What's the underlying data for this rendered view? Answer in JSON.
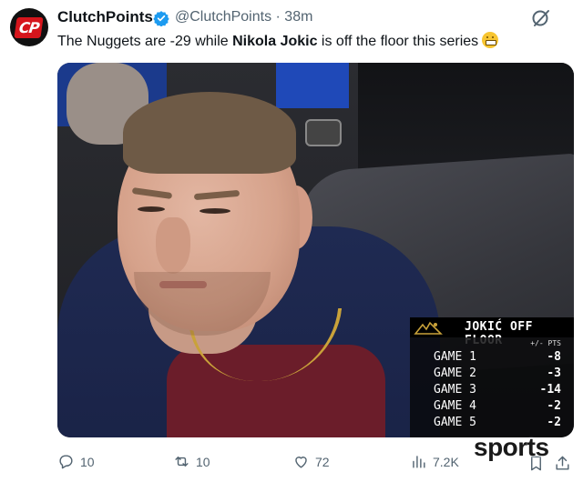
{
  "tweet": {
    "author_name": "ClutchPoints",
    "handle": "@ClutchPoints",
    "separator": "·",
    "time": "38m",
    "text_before": "The Nuggets are -29 while ",
    "text_bold": "Nikola Jokic",
    "text_after": " is off the floor this series",
    "emoji": "grimacing-face"
  },
  "overlay": {
    "title": "JOKIĆ OFF FLOOR",
    "column_header": "+/- PTS",
    "rows": [
      {
        "game": "GAME 1",
        "value": "-8"
      },
      {
        "game": "GAME 2",
        "value": "-3"
      },
      {
        "game": "GAME 3",
        "value": "-14"
      },
      {
        "game": "GAME 4",
        "value": "-2"
      },
      {
        "game": "GAME 5",
        "value": "-2"
      }
    ]
  },
  "actions": {
    "replies": "10",
    "reposts": "10",
    "likes": "72",
    "views": "7.2K"
  },
  "watermark": "sports",
  "colors": {
    "text_primary": "#0f1419",
    "text_secondary": "#536471",
    "verified_blue": "#1d9bf0",
    "brand_red": "#d6151c"
  }
}
